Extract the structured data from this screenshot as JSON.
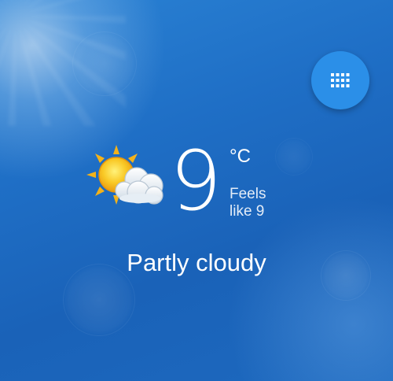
{
  "weather": {
    "condition_icon": "partly-cloudy-icon",
    "temperature": "9",
    "unit": "°C",
    "feels_like_line1": "Feels",
    "feels_like_line2": "like 9",
    "condition": "Partly cloudy"
  },
  "fab": {
    "icon": "grid-apps-icon"
  },
  "colors": {
    "fab_background": "#2b8fe8",
    "background_top": "#2a82d4",
    "background_bottom": "#1a62b8",
    "sun": "#f7b81f",
    "text": "#ffffff"
  }
}
